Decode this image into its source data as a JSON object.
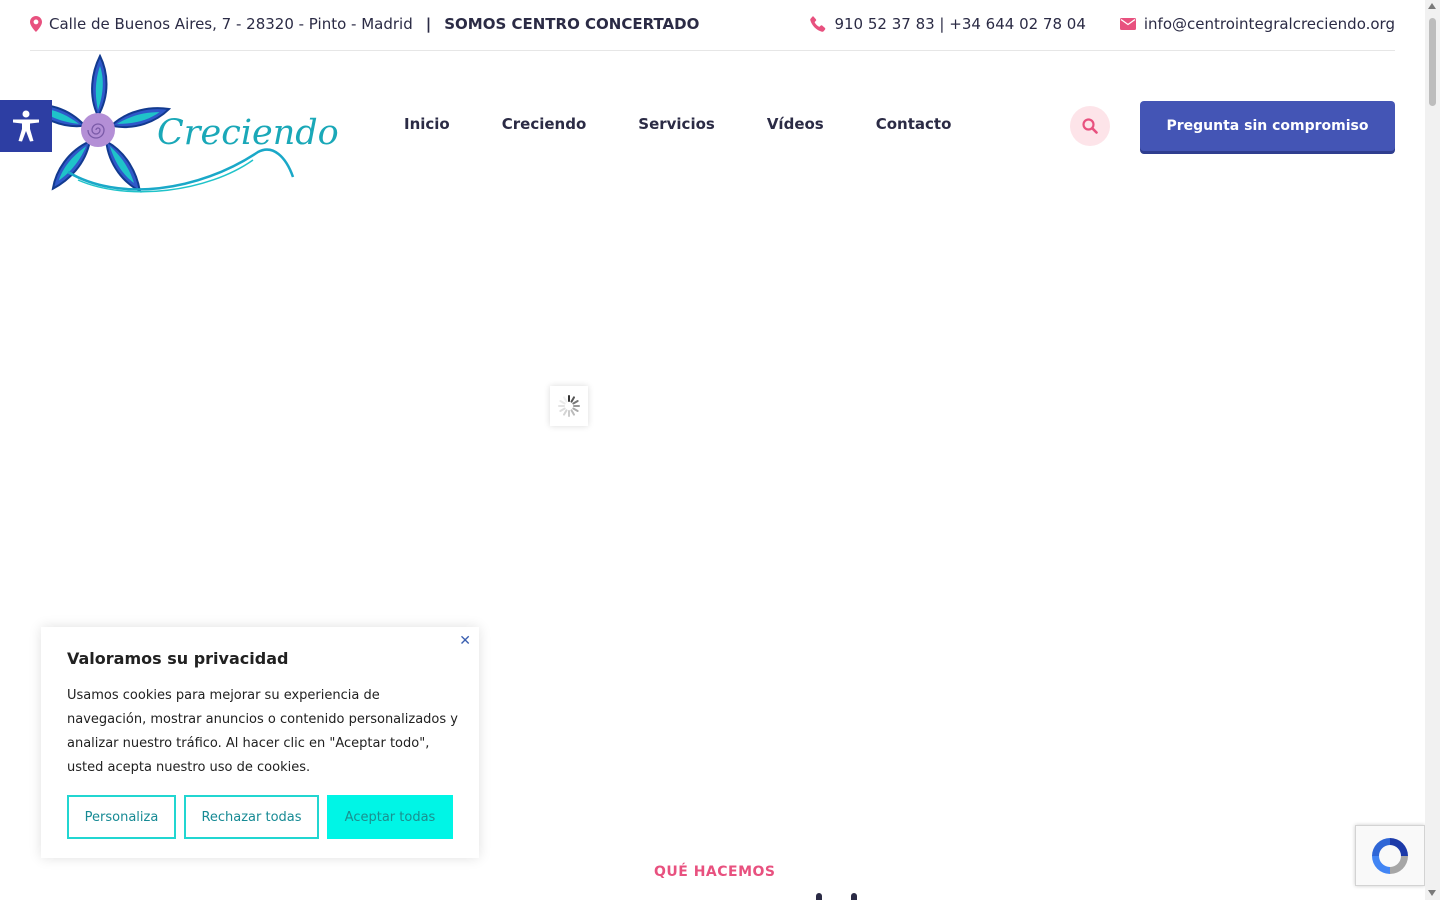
{
  "topbar": {
    "address": "Calle de Buenos Aires, 7 - 28320 - Pinto - Madrid",
    "separator": "|",
    "concertado": "SOMOS CENTRO CONCERTADO",
    "phone": "910 52 37 83 | +34 644 02 78 04",
    "email": "info@centrointegralcreciendo.org"
  },
  "logo": {
    "text": "Creciendo"
  },
  "nav": [
    {
      "label": "Inicio"
    },
    {
      "label": "Creciendo"
    },
    {
      "label": "Servicios"
    },
    {
      "label": "Vídeos"
    },
    {
      "label": "Contacto"
    }
  ],
  "header": {
    "cta_label": "Pregunta sin compromiso"
  },
  "cookie": {
    "title": "Valoramos su privacidad",
    "body": "Usamos cookies para mejorar su experiencia de navegación, mostrar anuncios o contenido personalizados y analizar nuestro tráfico. Al hacer clic en \"Aceptar todo\", usted acepta nuestro uso de cookies.",
    "customize_label": "Personaliza",
    "reject_label": "Rechazar todas",
    "accept_label": "Aceptar todas",
    "close_glyph": "✕"
  },
  "section": {
    "eyebrow": "QUÉ HACEMOS"
  },
  "colors": {
    "accent_pink": "#e8517f",
    "primary_blue": "#4455b5",
    "teal": "#00f5e6",
    "navy_text": "#2b2b45"
  },
  "icons": [
    "map-pin-icon",
    "phone-icon",
    "mail-icon",
    "search-icon",
    "accessibility-icon",
    "loading-spinner-icon",
    "recaptcha-icon"
  ]
}
